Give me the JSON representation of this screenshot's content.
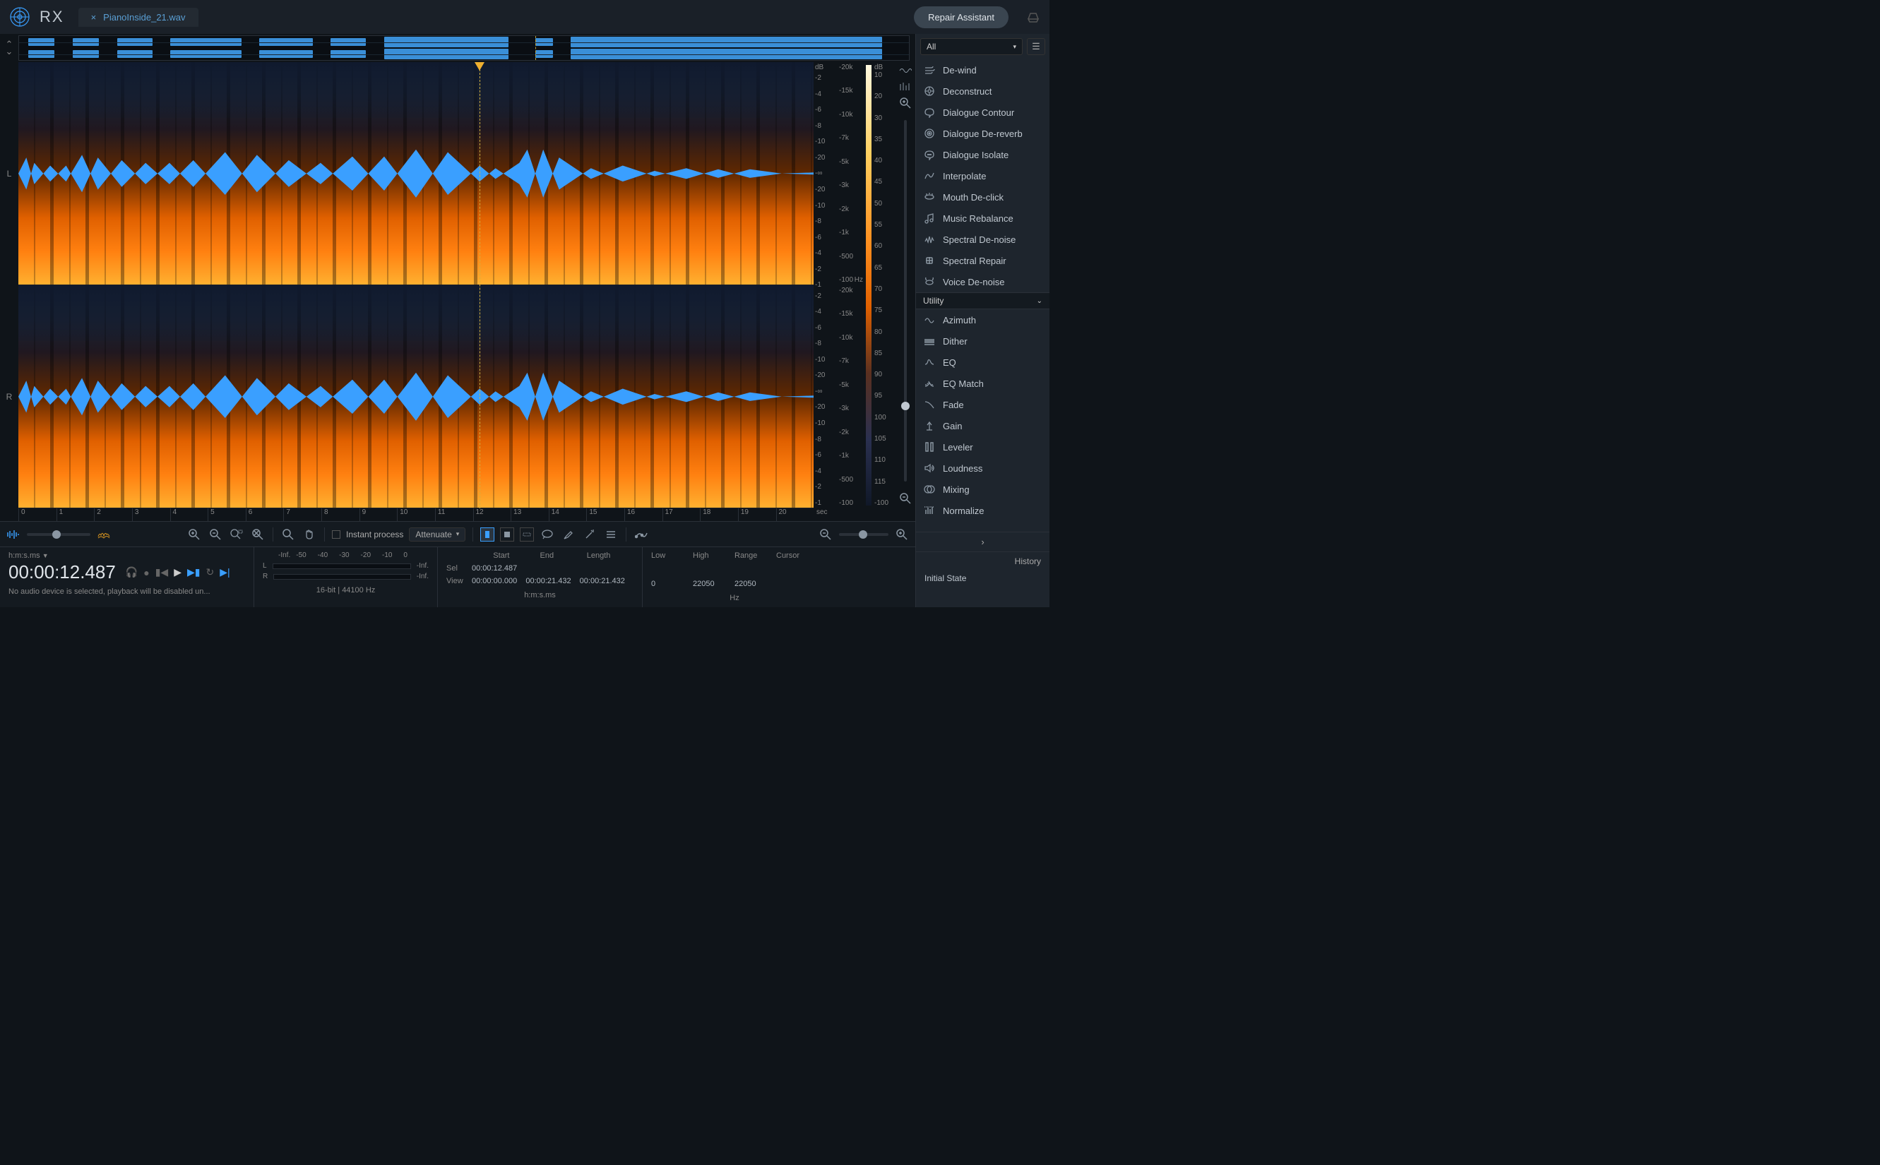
{
  "header": {
    "app": "RX",
    "tab_name": "PianoInside_21.wav",
    "repair_btn": "Repair Assistant"
  },
  "channels": {
    "left": "L",
    "right": "R"
  },
  "db_unit": "dB",
  "db_ticks": [
    "-2",
    "-4",
    "-6",
    "-8",
    "-10",
    "-20",
    "-∞",
    "-20",
    "-10",
    "-8",
    "-6",
    "-4",
    "-2",
    "-1"
  ],
  "hz_unit": "Hz",
  "hz_ticks": [
    "-20k",
    "-15k",
    "-10k",
    "-7k",
    "-5k",
    "-3k",
    "-2k",
    "-1k",
    "-500",
    "-100"
  ],
  "color_unit": "dB",
  "color_ticks": [
    "10",
    "20",
    "30",
    "35",
    "40",
    "45",
    "50",
    "55",
    "60",
    "65",
    "70",
    "75",
    "80",
    "85",
    "90",
    "95",
    "100",
    "105",
    "110",
    "115",
    "-100"
  ],
  "time_ticks": [
    "0",
    "1",
    "2",
    "3",
    "4",
    "5",
    "6",
    "7",
    "8",
    "9",
    "10",
    "11",
    "12",
    "13",
    "14",
    "15",
    "16",
    "17",
    "18",
    "19",
    "20"
  ],
  "time_unit": "sec",
  "toolbar": {
    "instant_process": "Instant process",
    "attenuate": "Attenuate"
  },
  "status": {
    "time_format": "h:m:s.ms",
    "time": "00:00:12.487",
    "message": "No audio device is selected, playback will be disabled un...",
    "meter_inf": "-Inf.",
    "meter_ticks": [
      "-50",
      "-40",
      "-30",
      "-20",
      "-10",
      "0"
    ],
    "meter_l": "L",
    "meter_r": "R",
    "meter_val": "-Inf.",
    "format": "16-bit | 44100 Hz",
    "col_start": "Start",
    "col_end": "End",
    "col_length": "Length",
    "row_sel": "Sel",
    "row_view": "View",
    "sel_start": "00:00:12.487",
    "view_start": "00:00:00.000",
    "view_end": "00:00:21.432",
    "view_length": "00:00:21.432",
    "hms": "h:m:s.ms",
    "col_low": "Low",
    "col_high": "High",
    "col_range": "Range",
    "col_cursor": "Cursor",
    "freq_low": "0",
    "freq_high": "22050",
    "freq_range": "22050",
    "freq_unit": "Hz"
  },
  "right": {
    "filter": "All",
    "category": "Utility",
    "modules1": [
      "De-wind",
      "Deconstruct",
      "Dialogue Contour",
      "Dialogue De-reverb",
      "Dialogue Isolate",
      "Interpolate",
      "Mouth De-click",
      "Music Rebalance",
      "Spectral De-noise",
      "Spectral Repair",
      "Voice De-noise"
    ],
    "modules2": [
      "Azimuth",
      "Dither",
      "EQ",
      "EQ Match",
      "Fade",
      "Gain",
      "Leveler",
      "Loudness",
      "Mixing",
      "Normalize"
    ],
    "history_hdr": "History",
    "history_item": "Initial State"
  }
}
